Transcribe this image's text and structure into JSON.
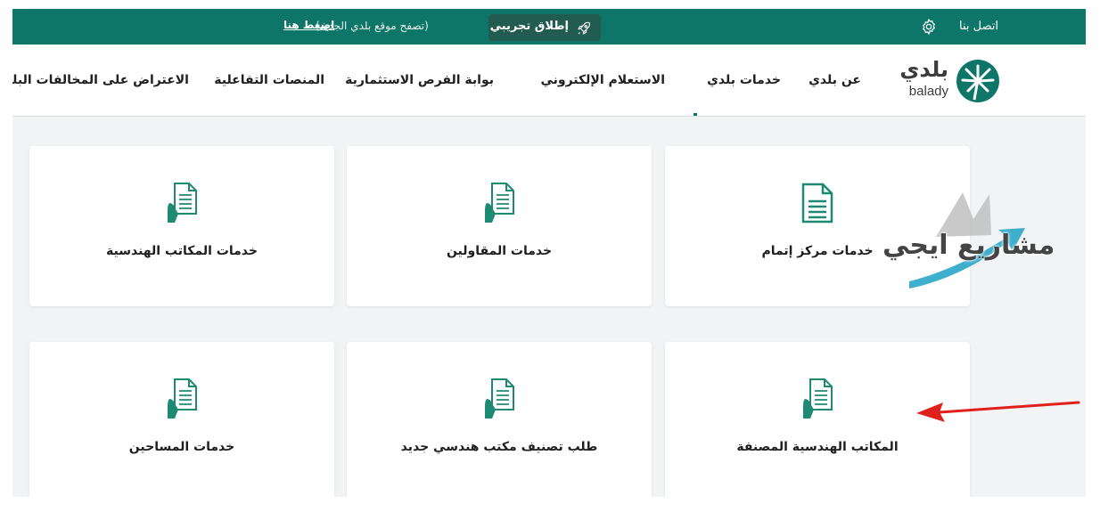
{
  "topbar": {
    "contact": "اتصل بنا",
    "beta_label": "إطلاق تجريبي",
    "beta_text": "(تصفح موقع بلدي الجديد)",
    "beta_link": "اضغط هنا"
  },
  "logo": {
    "ar": "بلدي",
    "en": "balady"
  },
  "nav": {
    "items": [
      "عن بلدي",
      "خدمات بلدي",
      "الاستعلام الإلكتروني",
      "بوابة الفرص الاستثمارية",
      "المنصات التفاعلية",
      "الاعتراض على المخالفات البلدية"
    ]
  },
  "cards": [
    {
      "title": "خدمات مركز إتمام",
      "icon": "document-icon"
    },
    {
      "title": "خدمات المقاولين",
      "icon": "hand-document-icon"
    },
    {
      "title": "خدمات المكاتب الهندسية",
      "icon": "hand-document-icon"
    },
    {
      "title": "المكاتب الهندسية المصنفة",
      "icon": "hand-document-icon"
    },
    {
      "title": "طلب تصنيف مكتب هندسي جديد",
      "icon": "hand-document-icon"
    },
    {
      "title": "خدمات المساحين",
      "icon": "hand-document-icon"
    }
  ],
  "watermark": {
    "text": "مشاريع ايجي"
  },
  "colors": {
    "brand": "#0e7569",
    "icon": "#1e8a73",
    "annotation_arrow": "#e0201b"
  }
}
